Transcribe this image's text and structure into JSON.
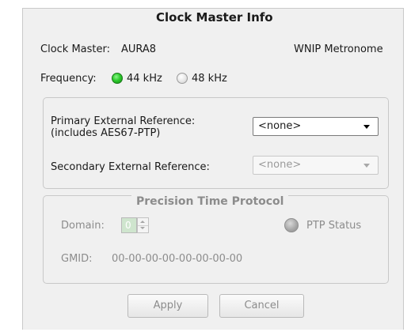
{
  "dialog": {
    "title": "Clock Master Info"
  },
  "clock_master": {
    "label": "Clock Master:",
    "value": "AURA8",
    "source": "WNIP Metronome"
  },
  "frequency": {
    "label": "Frequency:",
    "options": [
      {
        "label": "44 kHz",
        "selected": true,
        "color": "#2ecc2e"
      },
      {
        "label": "48 kHz",
        "selected": false,
        "color": "#e4e4e4"
      }
    ]
  },
  "references": {
    "primary_label_line1": "Primary External Reference:",
    "primary_label_line2": "(includes AES67-PTP)",
    "primary_value": "<none>",
    "secondary_label": "Secondary External Reference:",
    "secondary_value": "<none>"
  },
  "ptp": {
    "title": "Precision Time Protocol",
    "domain_label": "Domain:",
    "domain_value": "0",
    "status_label": "PTP Status",
    "gmid_label": "GMID:",
    "gmid_value": "00-00-00-00-00-00-00-00"
  },
  "buttons": {
    "apply": "Apply",
    "cancel": "Cancel"
  },
  "icons": {
    "frequency_selected": "radio-selected-icon",
    "frequency_unselected": "radio-unselected-icon",
    "dropdown": "chevron-down-icon",
    "ptp_status": "status-led-icon"
  },
  "colors": {
    "panel_background": "#f0f0f0",
    "selected_radio": "#2ecc2e",
    "disabled_text": "#8c8c8c",
    "ptp_status_led": "#a9a9a9"
  }
}
